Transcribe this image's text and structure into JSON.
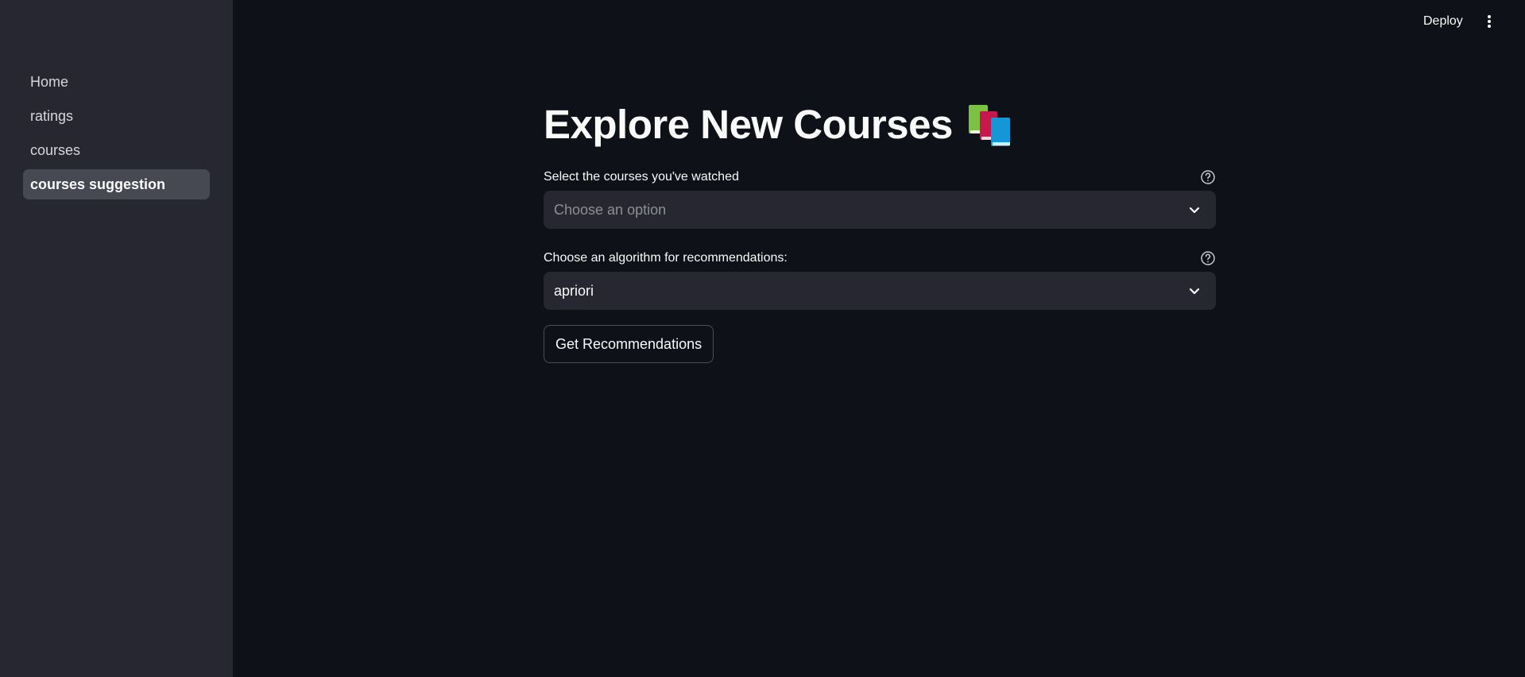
{
  "sidebar": {
    "items": [
      {
        "label": "Home"
      },
      {
        "label": "ratings"
      },
      {
        "label": "courses"
      },
      {
        "label": "courses suggestion"
      }
    ]
  },
  "header": {
    "deploy_label": "Deploy",
    "menu_icon": "kebab-menu-icon"
  },
  "main": {
    "title": "Explore New Courses",
    "title_icon": "books-emoji-icon",
    "courses_select": {
      "label": "Select the courses you've watched",
      "placeholder": "Choose an option",
      "help_icon": "help-circle-icon"
    },
    "algorithm_select": {
      "label": "Choose an algorithm for recommendations:",
      "value": "apriori",
      "help_icon": "help-circle-icon"
    },
    "button_label": "Get Recommendations"
  },
  "colors": {
    "background": "#0e1117",
    "sidebar": "#262730",
    "active_nav": "#464852",
    "input_bg": "#262730",
    "text": "#fafafa",
    "placeholder": "#8d8f97"
  }
}
